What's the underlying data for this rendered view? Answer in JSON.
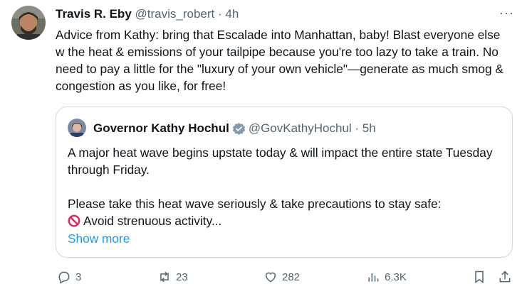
{
  "tweet": {
    "author_name": "Travis R. Eby",
    "handle_time": "@travis_robert · 4h",
    "more_icon": "more-dots-icon",
    "text": "Advice from Kathy: bring that Escalade into Manhattan, baby! Blast everyone else w the heat & emissions of your tailpipe because you're too lazy to take a train. No need to pay a little for the \"luxury of your own vehicle\"—generate as much smog & congestion as you like, for free!"
  },
  "quote": {
    "author_name": "Governor Kathy Hochul",
    "verified_icon": "government-badge-icon",
    "handle_time": "@GovKathyHochul · 5h",
    "line1": "A major heat wave begins upstate today & will impact the entire state Tuesday through Friday.",
    "line2": "Please take this heat wave seriously & take precautions to stay safe:",
    "line3": "Avoid strenuous activity...",
    "show_more": "Show more"
  },
  "actions": {
    "reply_count": "3",
    "retweet_count": "23",
    "like_count": "282",
    "views_count": "6.3K"
  },
  "colors": {
    "accent": "#1d9bf0",
    "secondary_text": "#536471",
    "border": "#cfd9de"
  }
}
